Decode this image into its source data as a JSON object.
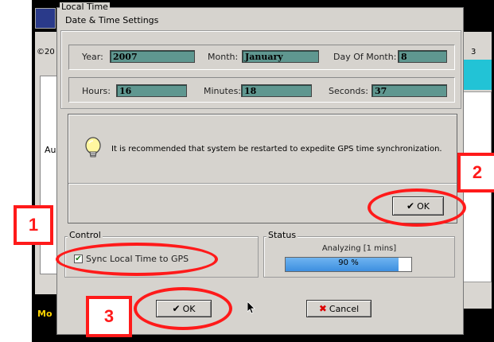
{
  "background_app": {
    "copyright_fragment": "©20",
    "side_label": "Au",
    "right_digit": "3",
    "bottom_text": "Mo"
  },
  "dialog": {
    "title": "Local Time",
    "datetime_group": {
      "legend": "Date & Time Settings",
      "year_label": "Year:",
      "year_value": "2007",
      "month_label": "Month:",
      "month_value": "January",
      "day_label": "Day Of Month:",
      "day_value": "8",
      "hours_label": "Hours:",
      "hours_value": "16",
      "minutes_label": "Minutes:",
      "minutes_value": "18",
      "seconds_label": "Seconds:",
      "seconds_value": "37"
    },
    "message": {
      "icon": "lightbulb-icon",
      "text": "It is recommended that system be restarted to expedite GPS time synchronization.",
      "ok_label": "OK"
    },
    "control": {
      "legend": "Control",
      "sync_label": "Sync Local Time to GPS",
      "sync_checked": true
    },
    "status": {
      "legend": "Status",
      "text": "Analyzing [1 mins]",
      "progress_percent": 90,
      "progress_label": "90 %"
    },
    "ok_label": "OK",
    "cancel_label": "Cancel"
  },
  "annotations": {
    "marker_1": "1",
    "marker_2": "2",
    "marker_3": "3",
    "color": "#ff1a1a"
  }
}
